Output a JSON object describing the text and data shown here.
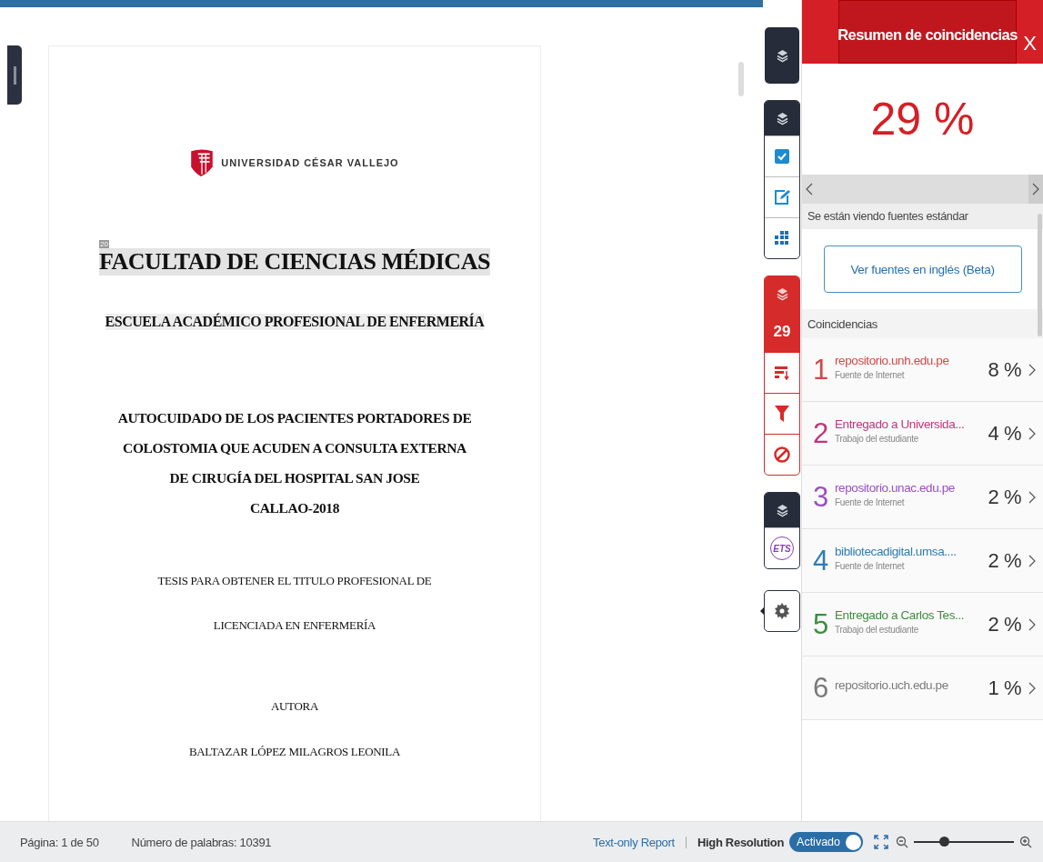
{
  "document": {
    "blocks": [
      {
        "kind": "logo",
        "lines": [
          "UNIVERSIDAD CÉSAR VALLEJO"
        ]
      },
      {
        "kind": "heading",
        "marker": "20",
        "lines": [
          "FACULTAD DE CIENCIAS MÉDICAS"
        ]
      },
      {
        "kind": "subheading",
        "lines": [
          "ESCUELA ACADÉMICO PROFESIONAL DE ENFERMERÍA"
        ]
      },
      {
        "kind": "title",
        "lines": [
          "AUTOCUIDADO DE LOS PACIENTES PORTADORES DE",
          "COLOSTOMIA QUE ACUDEN A CONSULTA EXTERNA",
          "DE CIRUGÍA DEL HOSPITAL SAN JOSE",
          "CALLAO-2018"
        ]
      },
      {
        "kind": "body",
        "lines": [
          "TESIS PARA OBTENER EL TITULO PROFESIONAL DE",
          "LICENCIADA EN ENFERMERÍA"
        ]
      },
      {
        "kind": "body",
        "lines": [
          "AUTORA"
        ]
      },
      {
        "kind": "body",
        "lines": [
          "BALTAZAR LÓPEZ MILAGROS LEONILA"
        ]
      }
    ]
  },
  "tools": [
    {
      "kind": "dark",
      "items": [
        {
          "kind": "layers"
        }
      ]
    },
    {
      "kind": "plain",
      "items": [
        {
          "kind": "layers"
        },
        {
          "kind": "check"
        },
        {
          "kind": "edit"
        },
        {
          "kind": "grid"
        }
      ]
    },
    {
      "kind": "red",
      "items": [
        {
          "kind": "layers"
        },
        {
          "kind": "count",
          "text": "29"
        },
        {
          "kind": "sort"
        },
        {
          "kind": "filter"
        },
        {
          "kind": "ban"
        }
      ]
    },
    {
      "kind": "plain",
      "items": [
        {
          "kind": "layers"
        },
        {
          "kind": "logo",
          "text": "ETS"
        }
      ]
    },
    {
      "kind": "plain",
      "items": [
        {
          "kind": "gear"
        }
      ]
    }
  ],
  "panel": {
    "title": "Resumen de coincidencias",
    "close": "X",
    "score": "29 %",
    "notice": "Se están viendo fuentes estándar",
    "button": "Ver fuentes en inglés (Beta)",
    "section": "Coincidencias",
    "matches": [
      {
        "number": "1",
        "name": "repositorio.unh.edu.pe",
        "type": "Fuente de Internet",
        "percent": "8 %",
        "color": "#d04848"
      },
      {
        "number": "2",
        "name": "Entregado a Universida...",
        "type": "Trabajo del estudiante",
        "percent": "4 %",
        "color": "#c2357c"
      },
      {
        "number": "3",
        "name": "repositorio.unac.edu.pe",
        "type": "Fuente de Internet",
        "percent": "2 %",
        "color": "#9a4fc2"
      },
      {
        "number": "4",
        "name": "bibliotecadigital.umsa....",
        "type": "Fuente de Internet",
        "percent": "2 %",
        "color": "#2f7db3"
      },
      {
        "number": "5",
        "name": "Entregado a Carlos Tes...",
        "type": "Trabajo del estudiante",
        "percent": "2 %",
        "color": "#3e8d3e"
      },
      {
        "number": "6",
        "name": "repositorio.uch.edu.pe",
        "percent": "1 %",
        "color": "#7a7a7a"
      }
    ]
  },
  "status_bar": {
    "page": "Página: 1 de 50",
    "words": "Número de palabras: 10391",
    "report_link": "Text-only Report",
    "resolution_label": "High Resolution",
    "toggle": {
      "label": "Activado",
      "on": true
    },
    "zoom": {
      "level": 0.3
    }
  }
}
